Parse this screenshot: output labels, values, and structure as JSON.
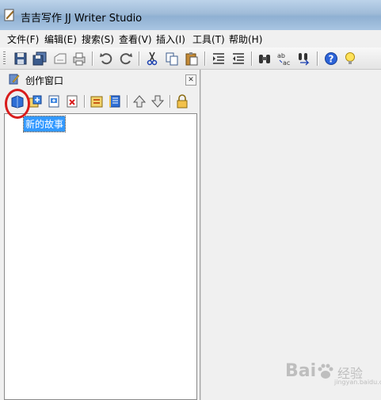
{
  "window": {
    "title": "吉吉写作 JJ Writer Studio"
  },
  "menu": [
    {
      "label": "文件(F)"
    },
    {
      "label": "编辑(E)"
    },
    {
      "label": "搜索(S)"
    },
    {
      "label": "查看(V)"
    },
    {
      "label": "插入(I)"
    },
    {
      "label": "工具(T)"
    },
    {
      "label": "帮助(H)"
    }
  ],
  "panel": {
    "title": "创作窗口",
    "close_glyph": "✕"
  },
  "tree": {
    "items": [
      {
        "label": "新的故事"
      }
    ]
  },
  "watermark": {
    "brand": "Bai",
    "text": "经验",
    "sub": "jingyan.baidu.com"
  },
  "colors": {
    "selection": "#3399ff",
    "highlight_circle": "#d81c1c"
  }
}
